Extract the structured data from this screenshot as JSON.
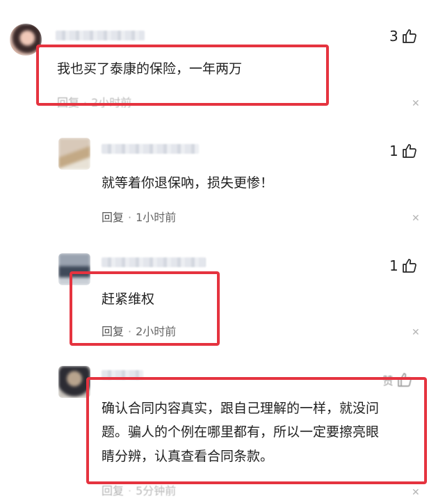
{
  "comments": [
    {
      "text": "我也买了泰康的保险，一年两万",
      "reply_label": "回复",
      "time": "2小时前",
      "likes": "3"
    },
    {
      "text": "就等着你退保吶，损失更惨！",
      "reply_label": "回复",
      "time": "1小时前",
      "likes": "1"
    },
    {
      "text": "赶紧维权",
      "reply_label": "回复",
      "time": "2小时前",
      "likes": "1"
    },
    {
      "text_lines": [
        "确认合同内容真实，跟自己理解的一样，就没问",
        "题。骗人的个例在哪里都有，所以一定要擦亮眼",
        "睛分辨，认真查看合同条款。"
      ],
      "reply_label": "回复",
      "time": "5分钟前",
      "likes": "赞"
    }
  ],
  "colors": {
    "highlight": "#e5333f",
    "meta": "#555555"
  },
  "icons": {
    "like": "thumbs-up-icon",
    "close": "close-icon"
  }
}
